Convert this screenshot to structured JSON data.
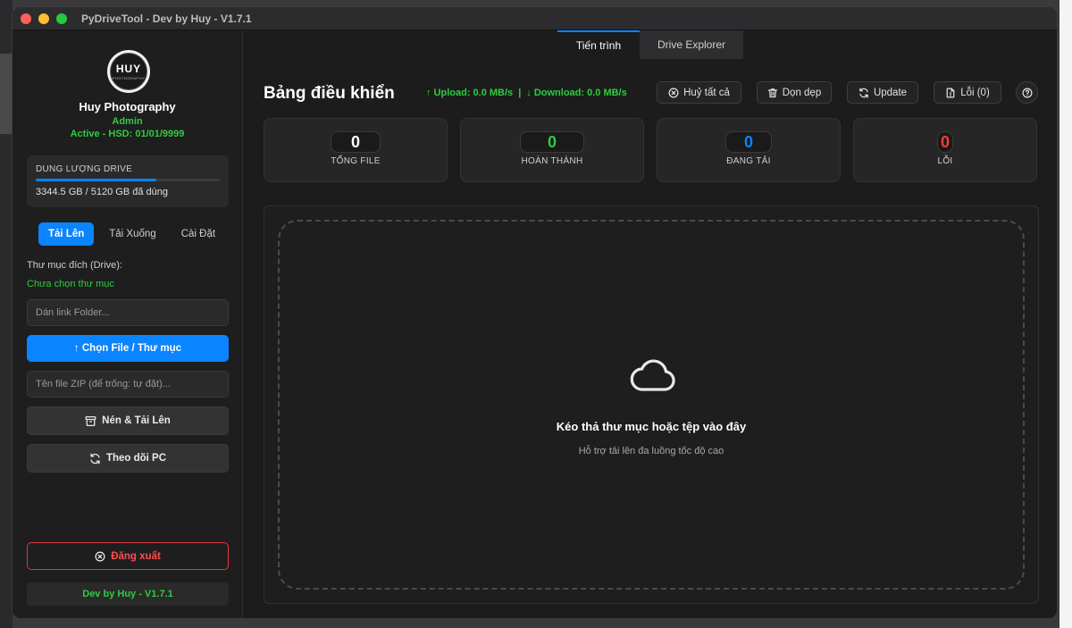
{
  "window": {
    "title": "PyDriveTool - Dev by Huy - V1.7.1"
  },
  "sidebar": {
    "logo": {
      "text": "HUY",
      "sub": "PHOTOGRAPHY"
    },
    "user_name": "Huy Photography",
    "role": "Admin",
    "status": "Active - HSD: 01/01/9999",
    "storage": {
      "title": "DUNG LƯỢNG DRIVE",
      "used_text": "3344.5 GB / 5120 GB đã dùng",
      "used_fraction": 0.653
    },
    "tabs": [
      {
        "label": "Tải Lên",
        "active": true
      },
      {
        "label": "Tải Xuống",
        "active": false
      },
      {
        "label": "Cài Đặt",
        "active": false
      }
    ],
    "target_label": "Thư mục đích (Drive):",
    "target_status": "Chưa chọn thư mục",
    "folder_link_placeholder": "Dán link Folder...",
    "choose_button": "↑ Chọn File / Thư mục",
    "zip_placeholder": "Tên file ZIP (để trống: tự đặt)...",
    "zip_button": "Nén & Tải Lên",
    "sync_button": "Theo dõi PC",
    "logout_button": "Đăng xuất",
    "footer": "Dev by Huy - V1.7.1"
  },
  "main": {
    "tabs": [
      {
        "label": "Tiến trình",
        "active": true
      },
      {
        "label": "Drive Explorer",
        "active": false
      }
    ],
    "title": "Bảng điều khiển",
    "upload_speed": "↑ Upload: 0.0 MB/s",
    "separator": "|",
    "download_speed": "↓ Download: 0.0 MB/s",
    "buttons": {
      "cancel_all": "Huỷ tất cả",
      "clean": "Dọn dẹp",
      "update": "Update",
      "errors": "Lỗi (0)"
    },
    "stats": [
      {
        "value": "0",
        "label": "TỔNG FILE",
        "color": "#ffffff"
      },
      {
        "value": "0",
        "label": "HOÀN THÀNH",
        "color": "#2ecc40"
      },
      {
        "value": "0",
        "label": "ĐANG TẢI",
        "color": "#0a84ff"
      },
      {
        "value": "0",
        "label": "LỖI",
        "color": "#ff3b30"
      }
    ],
    "drop": {
      "title": "Kéo thả thư mục hoặc tệp vào đây",
      "subtitle": "Hỗ trợ tải lên đa luồng tốc độ cao"
    }
  },
  "colors": {
    "accent": "#0a84ff",
    "success": "#2ecc40",
    "danger": "#ff3b30"
  }
}
